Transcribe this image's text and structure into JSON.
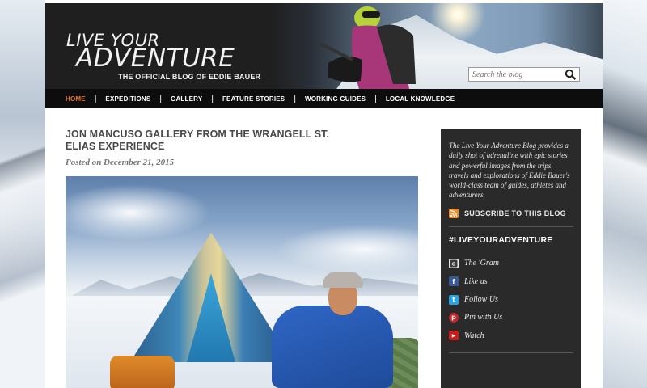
{
  "header": {
    "logo_line1": "LIVE YOUR",
    "logo_line2": "ADVENTURE",
    "tagline": "THE OFFICIAL BLOG OF EDDIE BAUER"
  },
  "search": {
    "placeholder": "Search the blog",
    "icon": "search-icon"
  },
  "nav": {
    "items": [
      {
        "label": "HOME",
        "active": true
      },
      {
        "label": "EXPEDITIONS"
      },
      {
        "label": "GALLERY"
      },
      {
        "label": "FEATURE STORIES"
      },
      {
        "label": "WORKING GUIDES"
      },
      {
        "label": "LOCAL KNOWLEDGE"
      }
    ],
    "active_color": "#e8742a"
  },
  "post": {
    "title": "JON MANCUSO GALLERY FROM THE WRANGELL ST. ELIAS EXPERIENCE",
    "date": "Posted on December 21, 2015"
  },
  "sidebar": {
    "about": "The Live Your Adventure Blog provides a daily shot of adrenaline with epic stories and powerful images from the trips, travels and explorations of Eddie Bauer's world-class team of guides, athletes and adventurers.",
    "subscribe_label": "SUBSCRIBE TO THIS BLOG",
    "hashtag": "#LIVEYOURADVENTURE",
    "social": [
      {
        "label": "The 'Gram",
        "icon": "instagram-icon"
      },
      {
        "label": "Like us",
        "icon": "facebook-icon"
      },
      {
        "label": "Follow Us",
        "icon": "twitter-icon"
      },
      {
        "label": "Pin with Us",
        "icon": "pinterest-icon"
      },
      {
        "label": "Watch",
        "icon": "youtube-icon"
      }
    ]
  },
  "colors": {
    "header_bg": "#1f1f1f",
    "nav_bg": "#0d0d0d",
    "sidebar_bg": "#2a2a2a",
    "rss": "#f08a24",
    "facebook": "#3b5998",
    "twitter": "#2aa3e0",
    "pinterest": "#cb2027",
    "youtube": "#cc1b1b"
  }
}
